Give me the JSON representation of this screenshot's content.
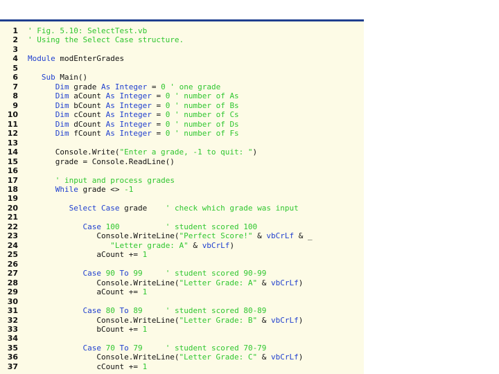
{
  "colors": {
    "keyword": "#1f3fcf",
    "comment": "#2fc62f",
    "string": "#2fc62f",
    "number": "#2fc62f",
    "plain": "#111111",
    "panel_background": "#fdfbe6",
    "top_rule": "#1f3f8f"
  },
  "code": {
    "lines": [
      {
        "n": "1",
        "tokens": [
          [
            "c",
            "' Fig. 5.10: SelectTest.vb"
          ]
        ]
      },
      {
        "n": "2",
        "tokens": [
          [
            "c",
            "' Using the Select Case structure."
          ]
        ]
      },
      {
        "n": "3",
        "tokens": []
      },
      {
        "n": "4",
        "tokens": [
          [
            "k",
            "Module"
          ],
          [
            "p",
            " modEnterGrades"
          ]
        ]
      },
      {
        "n": "5",
        "tokens": []
      },
      {
        "n": "6",
        "tokens": [
          [
            "p",
            "   "
          ],
          [
            "k",
            "Sub"
          ],
          [
            "p",
            " Main()"
          ]
        ]
      },
      {
        "n": "7",
        "tokens": [
          [
            "p",
            "      "
          ],
          [
            "k",
            "Dim"
          ],
          [
            "p",
            " grade "
          ],
          [
            "k",
            "As Integer"
          ],
          [
            "p",
            " = "
          ],
          [
            "n",
            "0"
          ],
          [
            "p",
            " "
          ],
          [
            "c",
            "' one grade"
          ]
        ]
      },
      {
        "n": "8",
        "tokens": [
          [
            "p",
            "      "
          ],
          [
            "k",
            "Dim"
          ],
          [
            "p",
            " aCount "
          ],
          [
            "k",
            "As Integer"
          ],
          [
            "p",
            " = "
          ],
          [
            "n",
            "0"
          ],
          [
            "p",
            " "
          ],
          [
            "c",
            "' number of As"
          ]
        ]
      },
      {
        "n": "9",
        "tokens": [
          [
            "p",
            "      "
          ],
          [
            "k",
            "Dim"
          ],
          [
            "p",
            " bCount "
          ],
          [
            "k",
            "As Integer"
          ],
          [
            "p",
            " = "
          ],
          [
            "n",
            "0"
          ],
          [
            "p",
            " "
          ],
          [
            "c",
            "' number of Bs"
          ]
        ]
      },
      {
        "n": "10",
        "tokens": [
          [
            "p",
            "      "
          ],
          [
            "k",
            "Dim"
          ],
          [
            "p",
            " cCount "
          ],
          [
            "k",
            "As Integer"
          ],
          [
            "p",
            " = "
          ],
          [
            "n",
            "0"
          ],
          [
            "p",
            " "
          ],
          [
            "c",
            "' number of Cs"
          ]
        ]
      },
      {
        "n": "11",
        "tokens": [
          [
            "p",
            "      "
          ],
          [
            "k",
            "Dim"
          ],
          [
            "p",
            " dCount "
          ],
          [
            "k",
            "As Integer"
          ],
          [
            "p",
            " = "
          ],
          [
            "n",
            "0"
          ],
          [
            "p",
            " "
          ],
          [
            "c",
            "' number of Ds"
          ]
        ]
      },
      {
        "n": "12",
        "tokens": [
          [
            "p",
            "      "
          ],
          [
            "k",
            "Dim"
          ],
          [
            "p",
            " fCount "
          ],
          [
            "k",
            "As Integer"
          ],
          [
            "p",
            " = "
          ],
          [
            "n",
            "0"
          ],
          [
            "p",
            " "
          ],
          [
            "c",
            "' number of Fs"
          ]
        ]
      },
      {
        "n": "13",
        "tokens": []
      },
      {
        "n": "14",
        "tokens": [
          [
            "p",
            "      Console.Write("
          ],
          [
            "s",
            "\"Enter a grade, -1 to quit: \""
          ],
          [
            "p",
            ")"
          ]
        ]
      },
      {
        "n": "15",
        "tokens": [
          [
            "p",
            "      grade = Console.ReadLine()"
          ]
        ]
      },
      {
        "n": "16",
        "tokens": []
      },
      {
        "n": "17",
        "tokens": [
          [
            "p",
            "      "
          ],
          [
            "c",
            "' input and process grades"
          ]
        ]
      },
      {
        "n": "18",
        "tokens": [
          [
            "p",
            "      "
          ],
          [
            "k",
            "While"
          ],
          [
            "p",
            " grade <> "
          ],
          [
            "n",
            "-1"
          ]
        ]
      },
      {
        "n": "19",
        "tokens": []
      },
      {
        "n": "20",
        "tokens": [
          [
            "p",
            "         "
          ],
          [
            "k",
            "Select Case"
          ],
          [
            "p",
            " grade    "
          ],
          [
            "c",
            "' check which grade was input"
          ]
        ]
      },
      {
        "n": "21",
        "tokens": []
      },
      {
        "n": "22",
        "tokens": [
          [
            "p",
            "            "
          ],
          [
            "k",
            "Case"
          ],
          [
            "p",
            " "
          ],
          [
            "n",
            "100"
          ],
          [
            "p",
            "          "
          ],
          [
            "c",
            "' student scored 100"
          ]
        ]
      },
      {
        "n": "23",
        "tokens": [
          [
            "p",
            "               Console.WriteLine("
          ],
          [
            "s",
            "\"Perfect Score!\""
          ],
          [
            "p",
            " & "
          ],
          [
            "k",
            "vbCrLf"
          ],
          [
            "p",
            " & _"
          ]
        ]
      },
      {
        "n": "24",
        "tokens": [
          [
            "p",
            "                  "
          ],
          [
            "s",
            "\"Letter grade: A\""
          ],
          [
            "p",
            " & "
          ],
          [
            "k",
            "vbCrLf"
          ],
          [
            "p",
            ")"
          ]
        ]
      },
      {
        "n": "25",
        "tokens": [
          [
            "p",
            "               aCount += "
          ],
          [
            "n",
            "1"
          ]
        ]
      },
      {
        "n": "26",
        "tokens": []
      },
      {
        "n": "27",
        "tokens": [
          [
            "p",
            "            "
          ],
          [
            "k",
            "Case"
          ],
          [
            "p",
            " "
          ],
          [
            "n",
            "90"
          ],
          [
            "p",
            " "
          ],
          [
            "k",
            "To"
          ],
          [
            "p",
            " "
          ],
          [
            "n",
            "99"
          ],
          [
            "p",
            "     "
          ],
          [
            "c",
            "' student scored 90-99"
          ]
        ]
      },
      {
        "n": "28",
        "tokens": [
          [
            "p",
            "               Console.WriteLine("
          ],
          [
            "s",
            "\"Letter Grade: A\""
          ],
          [
            "p",
            " & "
          ],
          [
            "k",
            "vbCrLf"
          ],
          [
            "p",
            ")"
          ]
        ]
      },
      {
        "n": "29",
        "tokens": [
          [
            "p",
            "               aCount += "
          ],
          [
            "n",
            "1"
          ]
        ]
      },
      {
        "n": "30",
        "tokens": []
      },
      {
        "n": "31",
        "tokens": [
          [
            "p",
            "            "
          ],
          [
            "k",
            "Case"
          ],
          [
            "p",
            " "
          ],
          [
            "n",
            "80"
          ],
          [
            "p",
            " "
          ],
          [
            "k",
            "To"
          ],
          [
            "p",
            " "
          ],
          [
            "n",
            "89"
          ],
          [
            "p",
            "     "
          ],
          [
            "c",
            "' student scored 80-89"
          ]
        ]
      },
      {
        "n": "32",
        "tokens": [
          [
            "p",
            "               Console.WriteLine("
          ],
          [
            "s",
            "\"Letter Grade: B\""
          ],
          [
            "p",
            " & "
          ],
          [
            "k",
            "vbCrLf"
          ],
          [
            "p",
            ")"
          ]
        ]
      },
      {
        "n": "33",
        "tokens": [
          [
            "p",
            "               bCount += "
          ],
          [
            "n",
            "1"
          ]
        ]
      },
      {
        "n": "34",
        "tokens": []
      },
      {
        "n": "35",
        "tokens": [
          [
            "p",
            "            "
          ],
          [
            "k",
            "Case"
          ],
          [
            "p",
            " "
          ],
          [
            "n",
            "70"
          ],
          [
            "p",
            " "
          ],
          [
            "k",
            "To"
          ],
          [
            "p",
            " "
          ],
          [
            "n",
            "79"
          ],
          [
            "p",
            "     "
          ],
          [
            "c",
            "' student scored 70-79"
          ]
        ]
      },
      {
        "n": "36",
        "tokens": [
          [
            "p",
            "               Console.WriteLine("
          ],
          [
            "s",
            "\"Letter Grade: C\""
          ],
          [
            "p",
            " & "
          ],
          [
            "k",
            "vbCrLf"
          ],
          [
            "p",
            ")"
          ]
        ]
      },
      {
        "n": "37",
        "tokens": [
          [
            "p",
            "               cCount += "
          ],
          [
            "n",
            "1"
          ]
        ]
      }
    ]
  }
}
